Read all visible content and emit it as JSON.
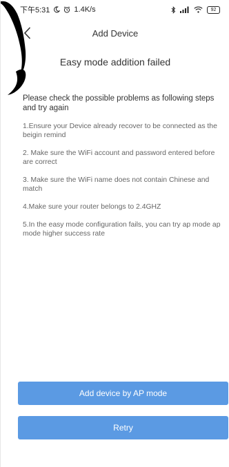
{
  "status_bar": {
    "time": "下午5:31",
    "network_speed": "1.4K/s",
    "battery_level": "92",
    "icons": [
      "moon-icon",
      "alarm-icon",
      "bluetooth-icon",
      "signal-icon",
      "wifi-icon",
      "battery-icon"
    ]
  },
  "header": {
    "title": "Add Device",
    "back_icon": "chevron-left-icon"
  },
  "main": {
    "fail_title": "Easy mode addition failed",
    "intro": "Please check the possible problems as following steps and try again",
    "steps": [
      "1.Ensure your Device already recover to be connected as the beigin remind",
      "2. Make sure the WiFi account and password entered before are correct",
      "3. Make sure the WiFi name does not contain Chinese and match",
      "4.Make sure your router belongs to 2.4GHZ",
      "5.In the easy mode configuration fails, you can try ap mode ap mode higher success rate"
    ]
  },
  "buttons": {
    "ap_mode_label": "Add device by AP mode",
    "retry_label": "Retry"
  },
  "colors": {
    "accent": "#5b9ae3",
    "text": "#333333",
    "secondary_text": "#666666"
  }
}
